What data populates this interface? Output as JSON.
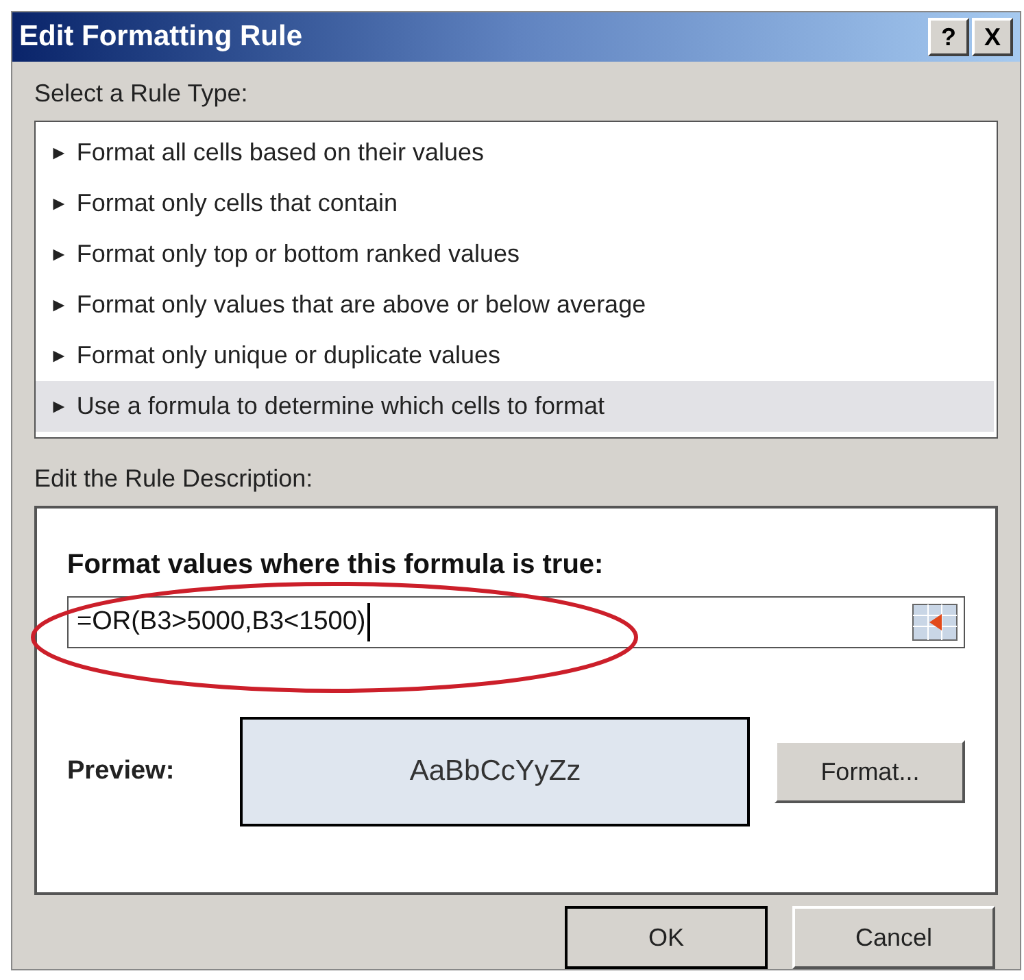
{
  "window": {
    "title": "Edit Formatting Rule",
    "controls": [
      "?",
      "X"
    ]
  },
  "rule_type": {
    "label": "Select a Rule Type:",
    "items": [
      {
        "marker": "►",
        "label": "Format all cells based on their values",
        "selected": false
      },
      {
        "marker": "►",
        "label": "Format only cells that contain",
        "selected": false
      },
      {
        "marker": "►",
        "label": "Format only top or bottom ranked values",
        "selected": false
      },
      {
        "marker": "►",
        "label": "Format only values that are above or below average",
        "selected": false
      },
      {
        "marker": "►",
        "label": "Format only unique or duplicate values",
        "selected": false
      },
      {
        "marker": "►",
        "label": "Use a formula to determine which cells to format",
        "selected": true
      }
    ]
  },
  "description": {
    "label": "Edit the Rule Description:",
    "heading": "Format values where this formula is true:",
    "formula": "=OR(B3>5000,B3<1500)",
    "preview_label": "Preview:",
    "preview_sample": "AaBbCcYyZz",
    "format_button": "Format..."
  },
  "buttons": [
    "OK",
    "Cancel"
  ]
}
